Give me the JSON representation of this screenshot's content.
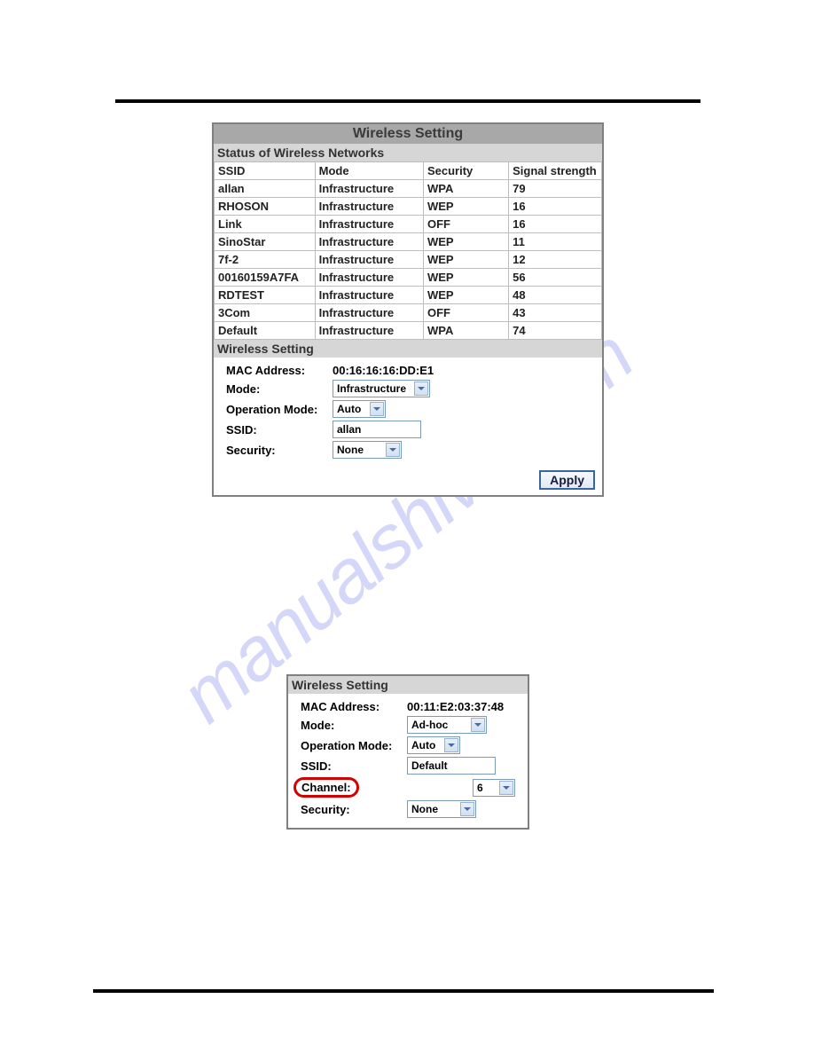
{
  "watermark": "manualshive.com",
  "panel1": {
    "title": "Wireless Setting",
    "status_header": "Status of Wireless Networks",
    "columns": {
      "c0": "SSID",
      "c1": "Mode",
      "c2": "Security",
      "c3": "Signal strength"
    },
    "rows": [
      {
        "ssid": "allan",
        "mode": "Infrastructure",
        "sec": "WPA",
        "sig": "79"
      },
      {
        "ssid": "RHOSON",
        "mode": "Infrastructure",
        "sec": "WEP",
        "sig": "16"
      },
      {
        "ssid": "Link",
        "mode": "Infrastructure",
        "sec": "OFF",
        "sig": "16"
      },
      {
        "ssid": "SinoStar",
        "mode": "Infrastructure",
        "sec": "WEP",
        "sig": "11"
      },
      {
        "ssid": "7f-2",
        "mode": "Infrastructure",
        "sec": "WEP",
        "sig": "12"
      },
      {
        "ssid": "00160159A7FA",
        "mode": "Infrastructure",
        "sec": "WEP",
        "sig": "56"
      },
      {
        "ssid": "RDTEST",
        "mode": "Infrastructure",
        "sec": "WEP",
        "sig": "48"
      },
      {
        "ssid": "3Com",
        "mode": "Infrastructure",
        "sec": "OFF",
        "sig": "43"
      },
      {
        "ssid": "Default",
        "mode": "Infrastructure",
        "sec": "WPA",
        "sig": "74"
      }
    ],
    "form_header": "Wireless Setting",
    "form": {
      "mac_label": "MAC Address:",
      "mac_value": "00:16:16:16:DD:E1",
      "mode_label": "Mode:",
      "mode_value": "Infrastructure",
      "op_label": "Operation Mode:",
      "op_value": "Auto",
      "ssid_label": "SSID:",
      "ssid_value": "allan",
      "sec_label": "Security:",
      "sec_value": "None",
      "apply": "Apply"
    }
  },
  "panel2": {
    "form_header": "Wireless Setting",
    "form": {
      "mac_label": "MAC Address:",
      "mac_value": "00:11:E2:03:37:48",
      "mode_label": "Mode:",
      "mode_value": "Ad-hoc",
      "op_label": "Operation Mode:",
      "op_value": "Auto",
      "ssid_label": "SSID:",
      "ssid_value": "Default",
      "chan_label": "Channel:",
      "chan_value": "6",
      "sec_label": "Security:",
      "sec_value": "None"
    }
  }
}
